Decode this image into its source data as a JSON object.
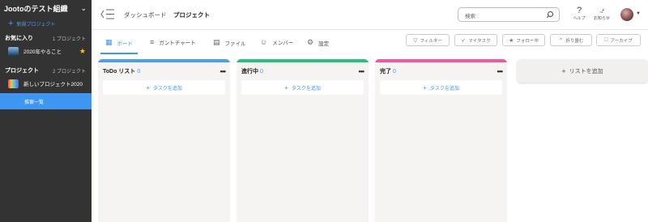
{
  "sidebar": {
    "org_name": "Jootoのテスト組織",
    "new_project": "新規プロジェクト",
    "favorites": {
      "title": "お気に入り",
      "count": "1 プロジェクト",
      "items": [
        {
          "label": "2020年やること"
        }
      ]
    },
    "projects": {
      "title": "プロジェクト",
      "count": "2 プロジェクト",
      "items": [
        {
          "label": "新しいプロジェクト2020"
        }
      ]
    },
    "active_item": "推案一覧"
  },
  "header": {
    "breadcrumb": [
      "ダッシュボード",
      "プロジェクト"
    ],
    "search_placeholder": "検索",
    "help_label": "ヘルプ",
    "notify_label": "お知らせ"
  },
  "tabs": [
    {
      "label": "ボード",
      "icon": "board-icon"
    },
    {
      "label": "ガントチャート",
      "icon": "gantt-icon"
    },
    {
      "label": "ファイル",
      "icon": "file-icon"
    },
    {
      "label": "メンバー",
      "icon": "member-icon"
    },
    {
      "label": "設定",
      "icon": "gear-icon"
    }
  ],
  "toolbar": {
    "filter": "フィルター",
    "my_task": "マイタスク",
    "follow": "フォロー中",
    "collapse": "折り畳む",
    "archive": "アーカイブ"
  },
  "lists": [
    {
      "title": "ToDo リスト",
      "count": "0",
      "color": "#4a9ff0",
      "add_task": "タスクを追加"
    },
    {
      "title": "進行中",
      "count": "0",
      "color": "#2dbf7e",
      "add_task": "タスクを追加"
    },
    {
      "title": "完了",
      "count": "0",
      "color": "#f0589f",
      "add_task": "タスクを追加"
    }
  ],
  "add_list": "リストを追加",
  "colors": {
    "accent": "#3d97f2",
    "sidebar": "#333333",
    "star": "#f5c518"
  }
}
